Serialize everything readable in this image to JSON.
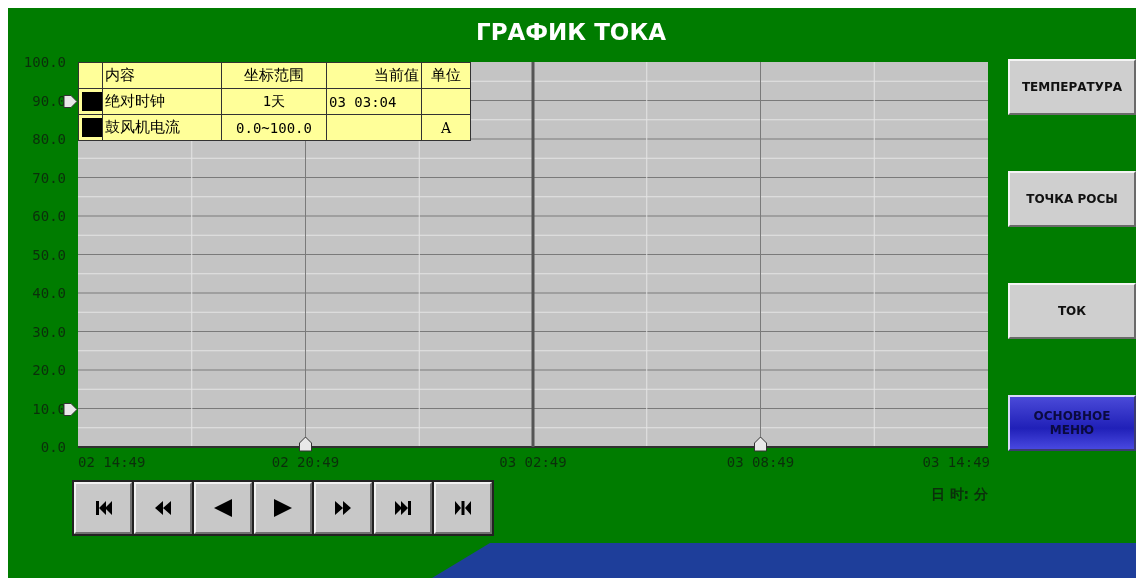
{
  "title": "ГРАФИК ТОКА",
  "legend": {
    "columns": [
      "内容",
      "坐标范围",
      "当前值",
      "单位"
    ],
    "rows": [
      {
        "color": "#000000",
        "name": "绝对时钟",
        "range": "1天",
        "value": "03 03:04"
      },
      {
        "color": "#000000",
        "name": "鼓风机电流",
        "range": "0.0~100.0",
        "unit": "A"
      }
    ]
  },
  "chart_data": {
    "type": "line",
    "xlabel": "日 时: 分",
    "ylim": [
      0,
      100
    ],
    "categories": [
      "02 14:49",
      "02 20:49",
      "03 02:49",
      "03 08:49",
      "03 14:49"
    ],
    "yticks": [
      {
        "value": 0,
        "label": "0.0"
      },
      {
        "value": 10,
        "label": "10.0"
      },
      {
        "value": 20,
        "label": "20.0"
      },
      {
        "value": 30,
        "label": "30.0"
      },
      {
        "value": 40,
        "label": "40.0"
      },
      {
        "value": 50,
        "label": "50.0"
      },
      {
        "value": 60,
        "label": "60.0"
      },
      {
        "value": 70,
        "label": "70.0"
      },
      {
        "value": 80,
        "label": "80.0"
      },
      {
        "value": 90,
        "label": "90.0"
      },
      {
        "value": 100,
        "label": "100.0"
      }
    ],
    "grid": true,
    "ref_lines": [
      {
        "axis": "x",
        "value": "03 02:49"
      }
    ]
  },
  "nav_buttons": [
    {
      "kind": "first"
    },
    {
      "kind": "fast_back"
    },
    {
      "kind": "back"
    },
    {
      "kind": "forward"
    },
    {
      "kind": "fast_forward"
    },
    {
      "kind": "last"
    },
    {
      "kind": "jump"
    }
  ],
  "side_buttons": [
    {
      "label": "ТЕМПЕРАТУРА",
      "kind": "plain"
    },
    {
      "label": "ТОЧКА РОСЫ",
      "kind": "plain"
    },
    {
      "label": "ТОК",
      "kind": "plain"
    },
    {
      "label": "ОСНОВНОЕ\nМЕНЮ",
      "kind": "menu"
    }
  ]
}
